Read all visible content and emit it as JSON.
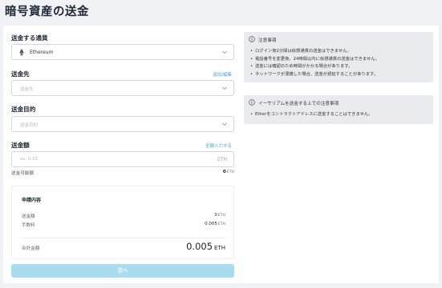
{
  "page": {
    "title": "暗号資産の送金"
  },
  "currency": {
    "label": "送金する通貨",
    "value": "Ethereum"
  },
  "destination": {
    "label": "送金先",
    "link": "追加/編集",
    "placeholder": "送金先"
  },
  "purpose": {
    "label": "送金目的",
    "placeholder": "送金目的"
  },
  "amount": {
    "label": "送金額",
    "link": "全額入力する",
    "placeholder": "ex. 0.01",
    "unit": "ETH",
    "available_label": "送金可能額",
    "available_value": "0",
    "available_unit": "ETH"
  },
  "summary": {
    "title": "申請内容",
    "rows": [
      {
        "label": "送金額",
        "value": "0",
        "unit": "ETH"
      },
      {
        "label": "手数料",
        "value": "0.005",
        "unit": "ETH"
      }
    ],
    "total_label": "合計金額",
    "total_value": "0.005",
    "total_unit": "ETH"
  },
  "next_button": "次へ",
  "notice1": {
    "title": "注意事項",
    "items": [
      "ログイン後2分間は仮想通貨の送金はできません。",
      "電話番号を変更後、24時間以内に仮想通貨の送金はできません。",
      "送金には確認のため時間がかかる場合があります。",
      "ネットワークが混雑した場合、送金が遅延することがあります。"
    ]
  },
  "notice2": {
    "title": "イーサリアムを送金する上での注意事項",
    "items": [
      "Etherをコントラクトアドレスに送金することはできません。"
    ]
  },
  "colors": {
    "accent": "#4aa3df",
    "button_disabled": "#a9dcef",
    "background": "#f0f2f5"
  },
  "icons": [
    "ethereum-icon",
    "chevron-down-icon",
    "info-icon"
  ]
}
